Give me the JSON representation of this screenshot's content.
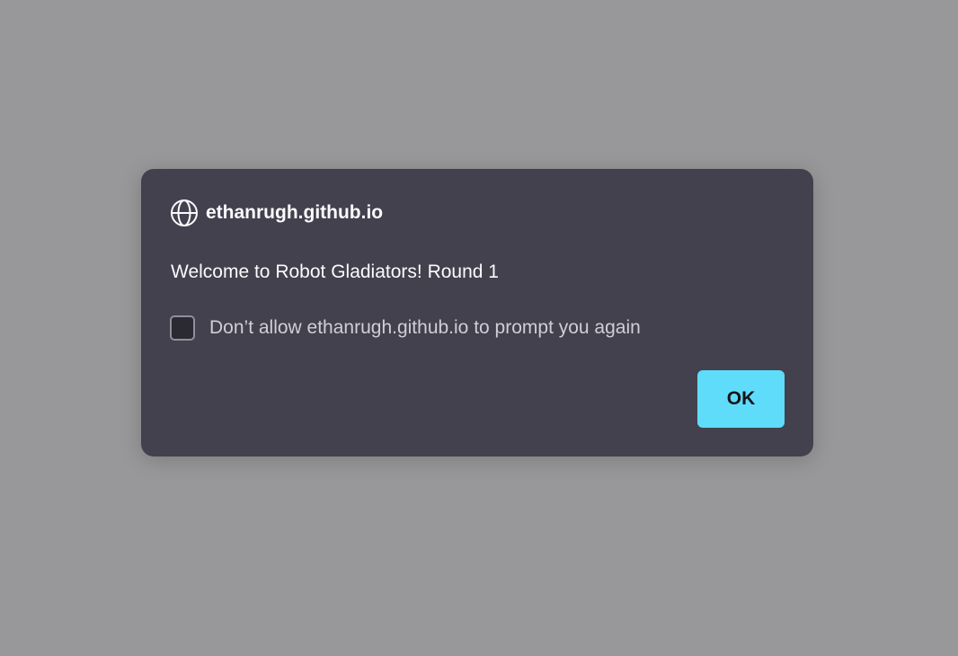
{
  "dialog": {
    "origin": "ethanrugh.github.io",
    "origin_icon": "globe-icon",
    "message": "Welcome to Robot Gladiators! Round 1",
    "checkbox_label": "Don’t allow ethanrugh.github.io to prompt you again",
    "checkbox_checked": false,
    "ok_label": "OK"
  },
  "colors": {
    "backdrop": "#98989a",
    "dialog_background": "#42414d",
    "accent": "#5fdcfa",
    "text": "#fbfbfe"
  }
}
